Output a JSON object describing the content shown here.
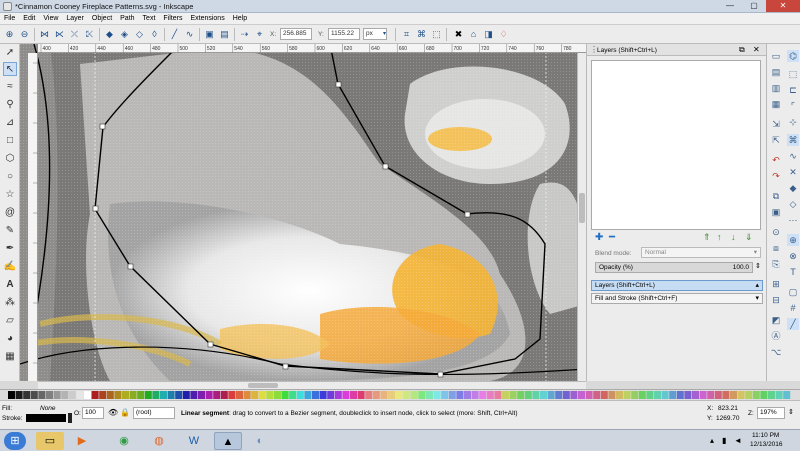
{
  "window": {
    "title": "*Cinnamon Cooney Fireplace Patterns.svg - Inkscape",
    "minimize": "—",
    "maximize": "▢",
    "close": "✕"
  },
  "menubar": {
    "items": [
      "File",
      "Edit",
      "View",
      "Layer",
      "Object",
      "Path",
      "Text",
      "Filters",
      "Extensions",
      "Help"
    ]
  },
  "toolbar": {
    "x_label": "X:",
    "x_value": "256.885",
    "y_label": "Y:",
    "y_value": "1155.22",
    "unit": "px"
  },
  "rulers": {
    "h_ticks": [
      "400",
      "420",
      "440",
      "460",
      "480",
      "500",
      "520",
      "540",
      "560",
      "580",
      "600",
      "620",
      "640",
      "660",
      "680",
      "700",
      "720",
      "740",
      "760",
      "780"
    ]
  },
  "layers_panel": {
    "title": "Layers (Shift+Ctrl+L)",
    "blend_mode_label": "Blend mode:",
    "blend_mode_value": "Normal",
    "opacity_label": "Opacity (%)",
    "opacity_value": "100.0",
    "tab_layers": "Layers (Shift+Ctrl+L)",
    "tab_fill_stroke": "Fill and Stroke (Shift+Ctrl+F)"
  },
  "status": {
    "fill_label": "Fill:",
    "fill_value": "None",
    "stroke_label": "Stroke:",
    "opacity_label": "O:",
    "opacity_value": "100",
    "layer_value": "(root)",
    "message_bold": "Linear segment",
    "message": ": drag to convert to a Bezier segment, doubleclick to insert node, click to select (more: Shift, Ctrl+Alt)",
    "cursor_x_label": "X:",
    "cursor_x": "823.21",
    "cursor_y_label": "Y:",
    "cursor_y": "1269.70",
    "zoom_label": "Z:",
    "zoom": "197%"
  },
  "taskbar": {
    "time": "11:10 PM",
    "date": "12/13/2016"
  },
  "colors": {
    "accent": "#3c78c3",
    "canvas_bg": "#7a7876",
    "highlight": "#f5b233"
  }
}
